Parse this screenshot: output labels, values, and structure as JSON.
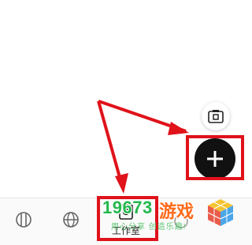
{
  "tabbar": {
    "studio_label": "工作室"
  },
  "watermark": {
    "number": "19673",
    "name": "游戏",
    "slogan": "用心分享 创造乐趣!"
  },
  "colors": {
    "highlight": "#e0121a",
    "fab_background": "#111111",
    "watermark_green": "#22b84c",
    "watermark_orange": "#ff6a1a"
  },
  "icons": {
    "camera_fab": "camera-icon",
    "add_fab": "plus-icon",
    "tab1": "sphere-icon",
    "tab2": "globe-icon",
    "tab3": "studio-icon",
    "watermark": "cube-logo-icon"
  }
}
